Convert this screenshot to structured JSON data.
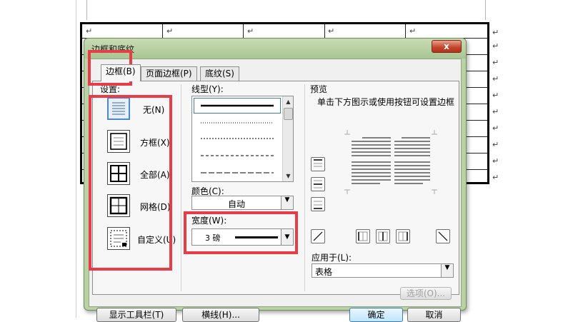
{
  "dialog": {
    "title": "边框和底纹",
    "close_glyph": "x",
    "tabs": [
      "边框(B)",
      "页面边框(P)",
      "底纹(S)"
    ]
  },
  "settings": {
    "label": "设置:",
    "items": [
      {
        "label": "无(N)"
      },
      {
        "label": "方框(X)"
      },
      {
        "label": "全部(A)"
      },
      {
        "label": "网格(D)"
      },
      {
        "label": "自定义(U)"
      }
    ]
  },
  "line_style": {
    "label": "线型(Y):"
  },
  "color": {
    "label": "颜色(C):",
    "value": "自动"
  },
  "width": {
    "label": "宽度(W):",
    "value": "3 磅"
  },
  "preview": {
    "label": "预览",
    "hint": "单击下方图示或使用按钮可设置边框"
  },
  "apply_to": {
    "label": "应用于(L):",
    "value": "表格"
  },
  "buttons": {
    "options": "选项(O)...",
    "toolbar": "显示工具栏(T)",
    "horizontal_line": "横线(H)...",
    "ok": "确定",
    "cancel": "取消"
  },
  "document": {
    "cell_mark": "↵"
  },
  "colors": {
    "highlight": "#e83d48",
    "dialog_frame": "#b9d1a4"
  }
}
